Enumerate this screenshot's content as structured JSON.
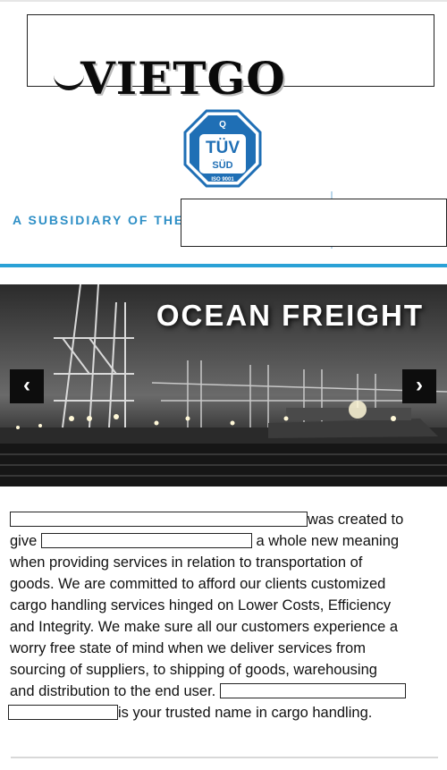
{
  "header": {
    "logo_text": "VIETGO",
    "tuv_badge": {
      "top": "Q",
      "main": "TÜV",
      "sub": "SÜD",
      "iso": "ISO 9001"
    },
    "subsidiary_text": "A SUBSIDIARY OF THE",
    "colors": {
      "accent_blue": "#2aa1d6",
      "subsidiary_blue": "#2e8fc6",
      "tuv_blue": "#1f6fb5"
    }
  },
  "banner": {
    "title": "OCEAN FREIGHT",
    "prev_icon": "chevron-left-icon",
    "next_icon": "chevron-right-icon",
    "prev_glyph": "‹",
    "next_glyph": "›"
  },
  "body": {
    "line1": "was created to",
    "line2_a": "give",
    "line2_b": "a whole new meaning",
    "line3": "when providing services in relation to transportation of",
    "line4": "goods. We are committed to afford our clients customized",
    "line5": "cargo handling services hinged on Lower Costs, Efficiency",
    "line6": "and Integrity. We make sure all our customers experience a",
    "line7": "worry free state of mind when we deliver services from",
    "line8": "sourcing of suppliers, to shipping of goods, warehousing",
    "line9": "and distribution to the end user.",
    "line10": "is your trusted name in cargo handling."
  }
}
